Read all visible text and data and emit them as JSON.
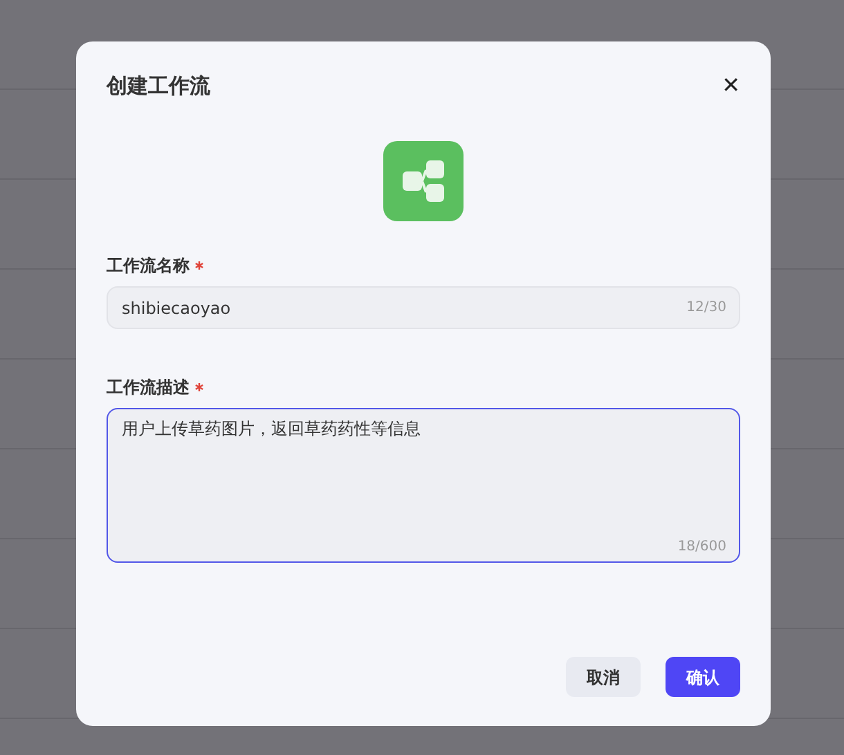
{
  "dialog": {
    "title": "创建工作流",
    "close": "✕"
  },
  "fields": [
    {
      "kind": "input",
      "label": "工作流名称",
      "required": true,
      "value": "shibiecaoyao",
      "counter": "12/30",
      "focused": false
    },
    {
      "kind": "textarea",
      "label": "工作流描述",
      "required": true,
      "value": "用户上传草药图片，返回草药药性等信息",
      "counter": "18/600",
      "focused": true
    }
  ],
  "buttons": [
    {
      "label": "取消",
      "primary": false
    },
    {
      "label": "确认",
      "primary": true
    }
  ]
}
